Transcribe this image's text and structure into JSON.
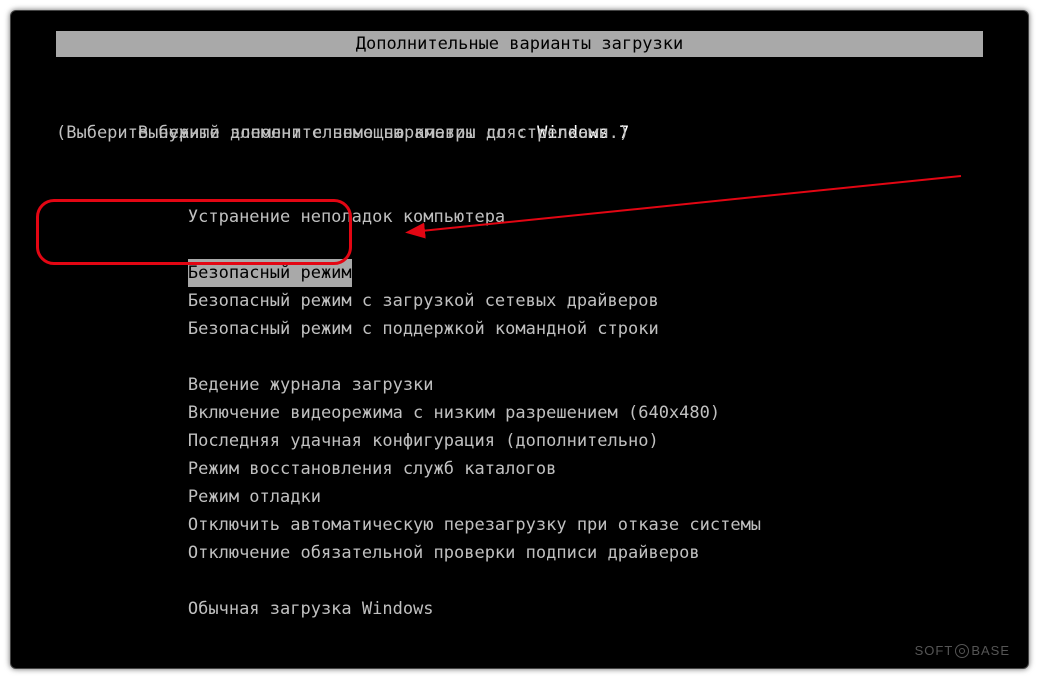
{
  "title": "Дополнительные варианты загрузки",
  "prompt_label": "Выберите дополнительные параметры для: ",
  "prompt_os": "Windows 7",
  "hint": "(Выберите нужный элемент с помощью клавиш со стрелками.)",
  "option_repair": "Устранение неполадок компьютера",
  "option_safe": "Безопасный режим",
  "option_safe_net": "Безопасный режим с загрузкой сетевых драйверов",
  "option_safe_cmd": "Безопасный режим с поддержкой командной строки",
  "option_bootlog": "Ведение журнала загрузки",
  "option_lowres": "Включение видеорежима с низким разрешением (640x480)",
  "option_lkg": "Последняя удачная конфигурация (дополнительно)",
  "option_dsrestore": "Режим восстановления служб каталогов",
  "option_debug": "Режим отладки",
  "option_noreboot": "Отключить автоматическую перезагрузку при отказе системы",
  "option_nosign": "Отключение обязательной проверки подписи драйверов",
  "option_normal": "Обычная загрузка Windows",
  "watermark_left": "SOFT",
  "watermark_right": "BASE"
}
